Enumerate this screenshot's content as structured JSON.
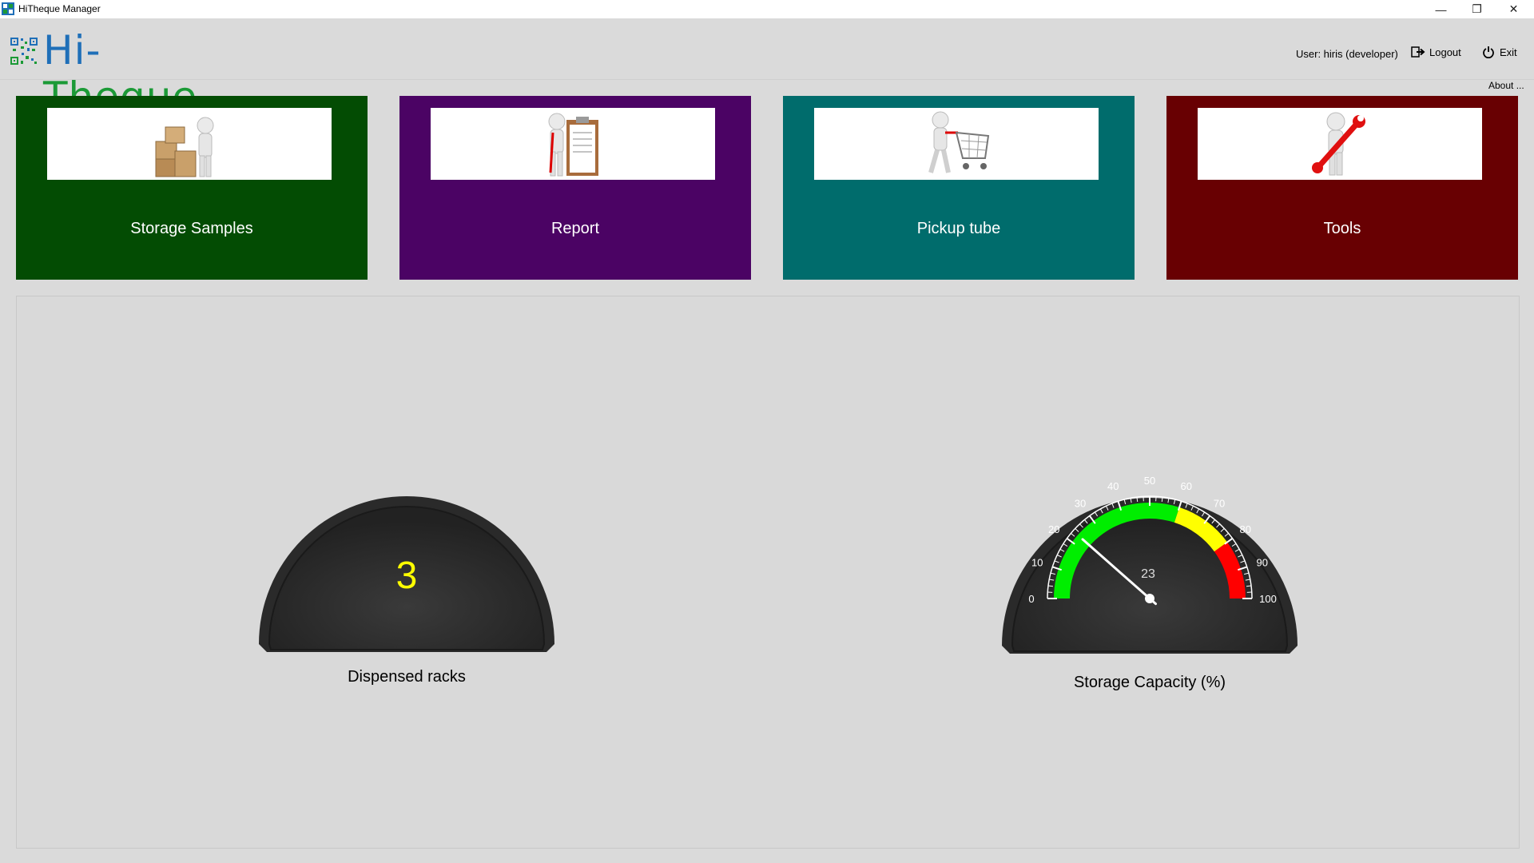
{
  "window": {
    "title": "HiTheque Manager",
    "minimize_glyph": "—",
    "maximize_glyph": "❐",
    "close_glyph": "✕"
  },
  "header": {
    "logo_text_prefix": "Hi-",
    "logo_text_suffix": "Theque",
    "user_info": "User: hiris (developer)",
    "logout_label": "Logout",
    "exit_label": "Exit",
    "about_label": "About ..."
  },
  "tiles": [
    {
      "label": "Storage Samples",
      "color": "#034c03",
      "icon": "boxes-figure-icon"
    },
    {
      "label": "Report",
      "color": "#4b0364",
      "icon": "clipboard-figure-icon"
    },
    {
      "label": "Pickup tube",
      "color": "#006c6c",
      "icon": "shopping-cart-figure-icon"
    },
    {
      "label": "Tools",
      "color": "#680002",
      "icon": "wrench-figure-icon"
    }
  ],
  "gauges": {
    "dispensed": {
      "label": "Dispensed racks",
      "value": "3",
      "value_color": "#ffff00"
    },
    "capacity": {
      "label": "Storage Capacity (%)",
      "value": 23,
      "value_text": "23",
      "min": 0,
      "max": 100,
      "ticks": [
        "0",
        "10",
        "20",
        "30",
        "40",
        "50",
        "60",
        "70",
        "80",
        "90",
        "100"
      ],
      "bands": [
        {
          "from": 0,
          "to": 60,
          "color": "#00ee00"
        },
        {
          "from": 60,
          "to": 80,
          "color": "#ffff00"
        },
        {
          "from": 80,
          "to": 100,
          "color": "#ff0000"
        }
      ]
    }
  }
}
